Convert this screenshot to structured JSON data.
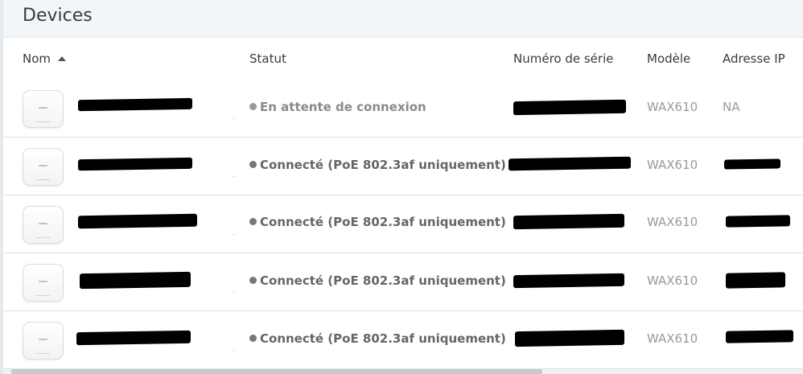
{
  "header": {
    "title": "Devices"
  },
  "columns": [
    {
      "label": "Nom",
      "sortable": true,
      "sort": "asc"
    },
    {
      "label": "Statut"
    },
    {
      "label": "Numéro de série"
    },
    {
      "label": "Modèle"
    },
    {
      "label": "Adresse IP"
    }
  ],
  "rows": [
    {
      "name": "",
      "status": "En attente de connexion",
      "status_state": "pending",
      "serial": "",
      "model": "WAX610",
      "ip": "NA",
      "icon": "access-point-image"
    },
    {
      "name": "",
      "status": "Connecté (PoE 802.3af uniquement)",
      "status_state": "connected",
      "serial": "",
      "model": "WAX610",
      "ip": "",
      "icon": "access-point-image"
    },
    {
      "name": "",
      "status": "Connecté (PoE 802.3af uniquement)",
      "status_state": "connected",
      "serial": "",
      "model": "WAX610",
      "ip": "",
      "icon": "access-point-image"
    },
    {
      "name": "",
      "status": "Connecté (PoE 802.3af uniquement)",
      "status_state": "connected",
      "serial": "",
      "model": "WAX610",
      "ip": "",
      "icon": "access-point-image"
    },
    {
      "name": "",
      "status": "Connecté (PoE 802.3af uniquement)",
      "status_state": "connected",
      "serial": "",
      "model": "WAX610",
      "ip": "",
      "icon": "access-point-image"
    }
  ],
  "colors": {
    "title_bar": "#f3f6f9",
    "status_pending": "#8a8a8a",
    "status_connected": "#666666",
    "muted": "#999999"
  }
}
